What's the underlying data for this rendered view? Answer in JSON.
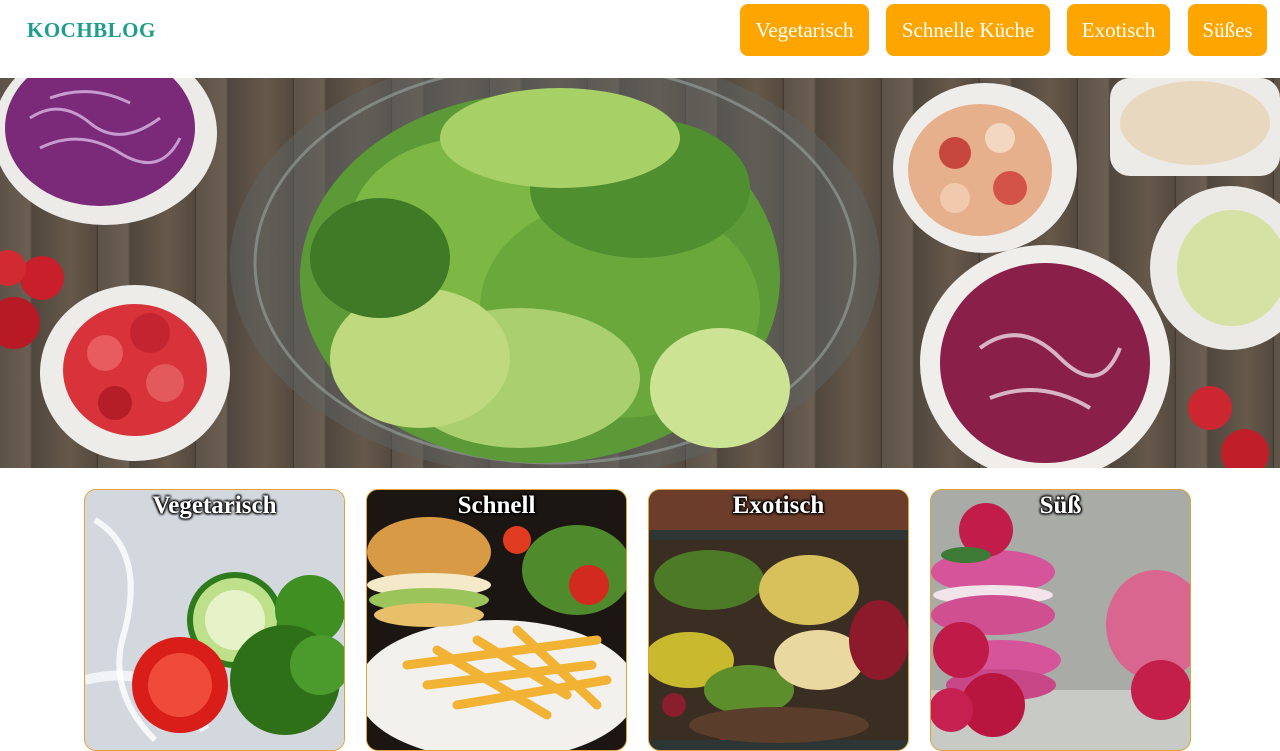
{
  "header": {
    "logo": "KOCHBLOG",
    "nav": [
      "Vegetarisch",
      "Schnelle Küche",
      "Exotisch",
      "Süßes"
    ]
  },
  "hero": {
    "image": "salad-ingredients-photo"
  },
  "cards": [
    {
      "title": "Vegetarisch",
      "image": "cucumber-tomato-water-splash-photo"
    },
    {
      "title": "Schnell",
      "image": "burger-and-fries-photo"
    },
    {
      "title": "Exotisch",
      "image": "floating-market-boat-photo"
    },
    {
      "title": "Süß",
      "image": "raspberry-macarons-photo"
    }
  ],
  "colors": {
    "logo": "#1e9e8c",
    "nav_button": "#ffa500",
    "card_border": "#e0a33a"
  }
}
